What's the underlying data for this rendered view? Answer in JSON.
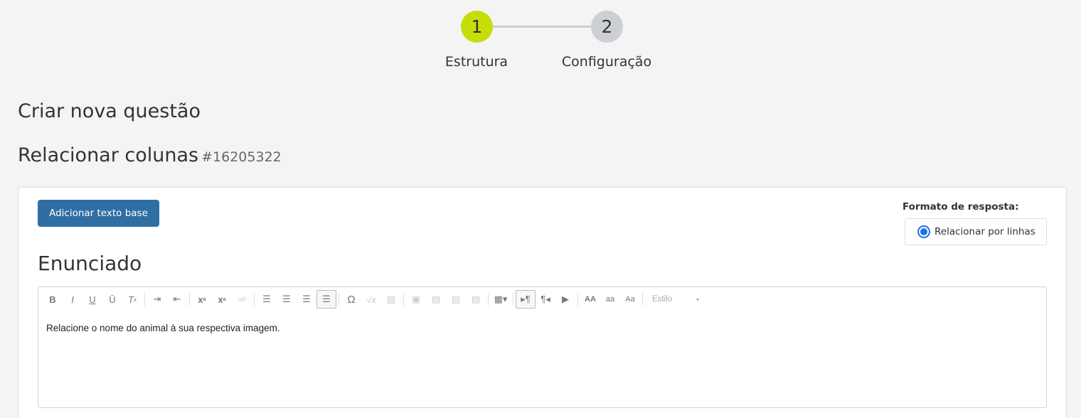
{
  "stepper": {
    "steps": [
      {
        "number": "1",
        "label": "Estrutura"
      },
      {
        "number": "2",
        "label": "Configuração"
      }
    ],
    "active_color": "#c6dd0a",
    "inactive_color": "#ccd0d4"
  },
  "page_title": "Criar nova questão",
  "section": {
    "title": "Relacionar colunas",
    "id": "#16205322"
  },
  "card": {
    "add_base_text_button": "Adicionar texto base",
    "response_format_label": "Formato de resposta:",
    "response_option": "Relacionar por linhas",
    "enunciado_title": "Enunciado"
  },
  "toolbar": {
    "icons": [
      "bold-icon",
      "italic-icon",
      "underline-icon",
      "overline-icon",
      "remove-format-icon",
      "indent-icon",
      "outdent-icon",
      "subscript-icon",
      "superscript-icon",
      "ref-icon",
      "align-left-icon",
      "align-center-icon",
      "align-right-icon",
      "justify-icon",
      "omega-icon",
      "sqrt-icon",
      "formula-icon",
      "image-icon",
      "table-icon",
      "paragraph-ltr-icon",
      "paragraph-rtl-icon",
      "youtube-icon",
      "uppercase-icon",
      "lowercase-icon",
      "capitalize-icon"
    ],
    "style_label": "Estilo"
  },
  "editor": {
    "content": "Relacione o nome do animal à sua respectiva imagem."
  },
  "colors": {
    "primary_button": "#2f6ea3",
    "radio": "#1a73e8"
  }
}
